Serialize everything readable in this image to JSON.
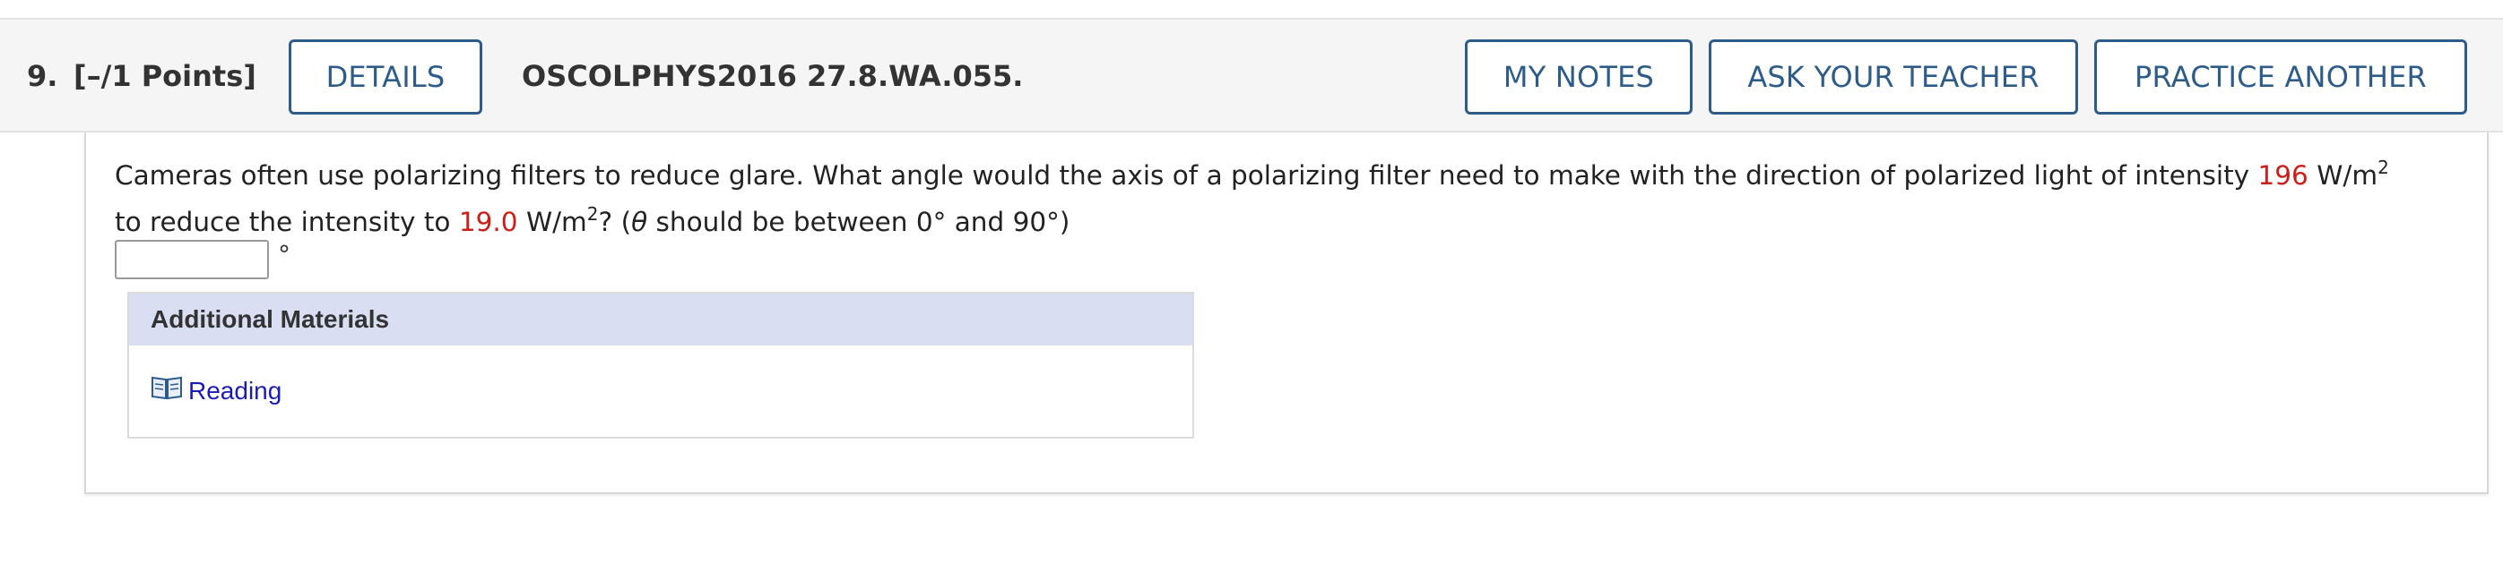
{
  "question": {
    "number": "9.",
    "points": "[–/1 Points]",
    "details_label": "DETAILS",
    "code": "OSCOLPHYS2016 27.8.WA.055."
  },
  "toolbar": {
    "my_notes_label": "MY NOTES",
    "ask_teacher_label": "ASK YOUR TEACHER",
    "practice_label": "PRACTICE ANOTHER"
  },
  "problem": {
    "text_part1": "Cameras often use polarizing filters to reduce glare. What angle would the axis of a polarizing filter need to make with the direction of polarized light of intensity ",
    "intensity1": "196",
    "unit_base": "W/m",
    "unit_exp": "2",
    "text_part2": " to reduce the intensity to ",
    "intensity2": "19.0",
    "text_part3": "? (",
    "theta": "θ",
    "text_part4": " should be between 0° and 90°)",
    "answer_value": "",
    "answer_unit": "°"
  },
  "additional": {
    "title": "Additional Materials",
    "reading_label": "Reading",
    "reading_icon": "book-icon"
  },
  "colors": {
    "accent": "#2e5c8a",
    "highlight_value": "#cc1f1a",
    "materials_header_bg": "#d9def3",
    "link": "#1b1bb5"
  }
}
